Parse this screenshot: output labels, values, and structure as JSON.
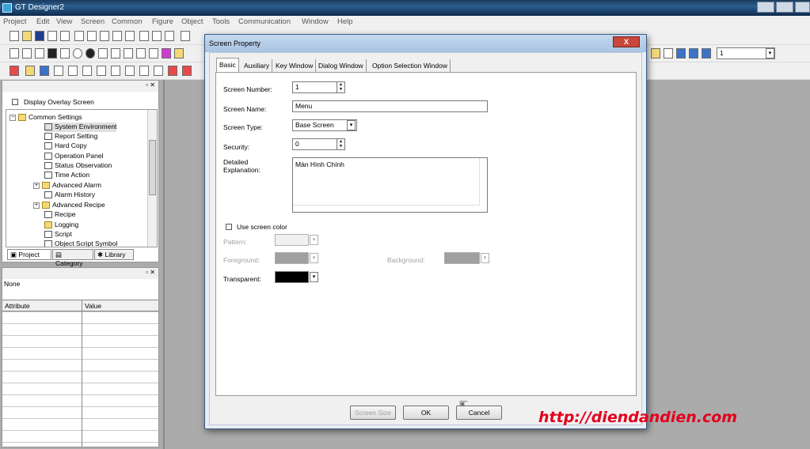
{
  "window": {
    "title": "GT Designer2"
  },
  "menu": [
    "Project",
    "Edit",
    "View",
    "Screen",
    "Common",
    "Figure",
    "Object",
    "Tools",
    "Communication",
    "Window",
    "Help"
  ],
  "toolbar": {
    "page_field": "1"
  },
  "project_pane": {
    "overlay_checkbox_label": "Display Overlay Screen",
    "tree": [
      {
        "label": "Common Settings",
        "expanded": true
      },
      {
        "label": "System Environment"
      },
      {
        "label": "Report Setting"
      },
      {
        "label": "Hard Copy"
      },
      {
        "label": "Operation Panel"
      },
      {
        "label": "Status Observation"
      },
      {
        "label": "Time Action"
      },
      {
        "label": "Advanced Alarm"
      },
      {
        "label": "Alarm History"
      },
      {
        "label": "Advanced Recipe"
      },
      {
        "label": "Recipe"
      },
      {
        "label": "Logging"
      },
      {
        "label": "Script"
      },
      {
        "label": "Object Script Symbol"
      }
    ],
    "tabs": [
      "Project",
      "Category",
      "Library"
    ]
  },
  "property_pane": {
    "selection": "None",
    "columns": [
      "Attribute",
      "Value"
    ]
  },
  "dialog": {
    "title": "Screen Property",
    "close_glyph": "X",
    "tabs": [
      "Basic",
      "Auxiliary",
      "Key Window",
      "Dialog Window",
      "Option Selection Window"
    ],
    "active_tab": "Basic",
    "screen_number_label": "Screen Number:",
    "screen_number": "1",
    "screen_name_label": "Screen Name:",
    "screen_name": "Menu",
    "screen_type_label": "Screen Type:",
    "screen_type": "Base Screen",
    "security_label": "Security:",
    "security": "0",
    "explanation_label": "Detailed Explanation:",
    "explanation": "Màn Hình Chính",
    "use_screen_color_label": "Use screen color",
    "pattern_label": "Pattern:",
    "foreground_label": "Foreground:",
    "background_label": "Background:",
    "transparent_label": "Transparent:",
    "buttons": {
      "screen_size": "Screen Size",
      "ok": "OK",
      "cancel": "Cancel"
    }
  },
  "watermark": "http://diendandien.com",
  "colors": {
    "titlebar": "#2a5f8f",
    "transparent_swatch": "#000000",
    "disabled_swatch": "#a0a0a0",
    "watermark": "#e3001b"
  }
}
